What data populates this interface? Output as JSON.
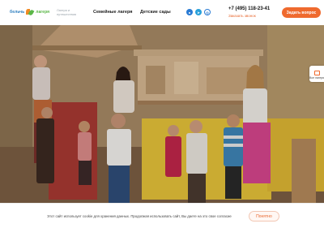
{
  "header": {
    "logo_text_a": "бельчь",
    "logo_text_b": "лагеря",
    "tagline": "Лагеря и путешествия",
    "nav": [
      {
        "label": "Семейные лагеря"
      },
      {
        "label": "Детские сады"
      }
    ],
    "socials": [
      {
        "icon": "vk-icon",
        "glyph": "в"
      },
      {
        "icon": "telegram-icon",
        "glyph": "➤"
      },
      {
        "icon": "viber-icon",
        "glyph": "◎"
      }
    ],
    "phone": "+7 (495) 118-23-41",
    "callback_label": "Заказать звонок",
    "ask_button": "Задать вопрос"
  },
  "hero": {
    "side_badge_label": "Все лагеря"
  },
  "cookie": {
    "text": "Этот сайт использует cookie для хранения данных. Продолжая использовать сайт, Вы даете на это свое согласие",
    "button": "Понятно"
  },
  "colors": {
    "accent": "#ef6a2e",
    "brand_blue": "#2f7fbf",
    "brand_green": "#5bb748"
  }
}
